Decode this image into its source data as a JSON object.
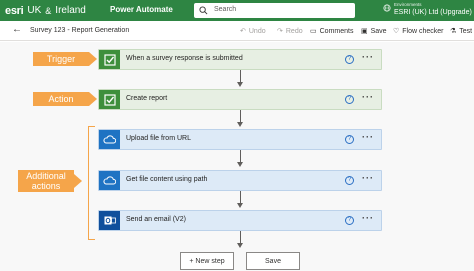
{
  "header": {
    "logo_mark": "esri",
    "logo_org_1": "UK",
    "logo_amp": "&",
    "logo_org_2": "Ireland",
    "app_name": "Power Automate",
    "search_placeholder": "Search",
    "environments_label": "Environments",
    "environment_name": "ESRI (UK) Ltd (Upgrade)"
  },
  "command_bar": {
    "back_icon": "arrow-left-icon",
    "breadcrumb": "Survey 123 - Report Generation",
    "undo": "Undo",
    "redo": "Redo",
    "comments": "Comments",
    "save": "Save",
    "flow_checker": "Flow checker",
    "test": "Test"
  },
  "annotations": {
    "trigger": "Trigger",
    "action": "Action",
    "additional_line1": "Additional",
    "additional_line2": "actions"
  },
  "steps": [
    {
      "label": "When a survey response is submitted",
      "icon": "checklist-icon",
      "kind": "survey123"
    },
    {
      "label": "Create report",
      "icon": "checklist-icon",
      "kind": "survey123"
    },
    {
      "label": "Upload file from URL",
      "icon": "cloud-icon",
      "kind": "onedrive"
    },
    {
      "label": "Get file content using path",
      "icon": "cloud-icon",
      "kind": "onedrive"
    },
    {
      "label": "Send an email (V2)",
      "icon": "outlook-icon",
      "kind": "outlook"
    }
  ],
  "help_glyph": "?",
  "more_glyph": "···",
  "footer": {
    "new_step": "+ New step",
    "save": "Save"
  },
  "colors": {
    "header": "#2e8543",
    "annotation": "#f5a54a",
    "trigger_card": "#e7efe3",
    "action_card": "#ddeaf7"
  }
}
